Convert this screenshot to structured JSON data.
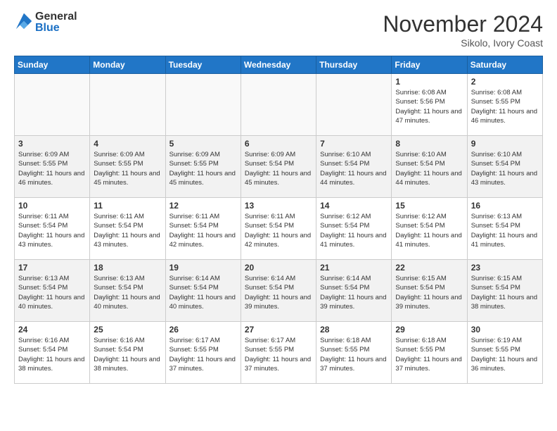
{
  "header": {
    "logo_general": "General",
    "logo_blue": "Blue",
    "month_title": "November 2024",
    "location": "Sikolo, Ivory Coast"
  },
  "days_of_week": [
    "Sunday",
    "Monday",
    "Tuesday",
    "Wednesday",
    "Thursday",
    "Friday",
    "Saturday"
  ],
  "weeks": [
    [
      {
        "day": "",
        "text": ""
      },
      {
        "day": "",
        "text": ""
      },
      {
        "day": "",
        "text": ""
      },
      {
        "day": "",
        "text": ""
      },
      {
        "day": "",
        "text": ""
      },
      {
        "day": "1",
        "text": "Sunrise: 6:08 AM\nSunset: 5:56 PM\nDaylight: 11 hours and 47 minutes."
      },
      {
        "day": "2",
        "text": "Sunrise: 6:08 AM\nSunset: 5:55 PM\nDaylight: 11 hours and 46 minutes."
      }
    ],
    [
      {
        "day": "3",
        "text": "Sunrise: 6:09 AM\nSunset: 5:55 PM\nDaylight: 11 hours and 46 minutes."
      },
      {
        "day": "4",
        "text": "Sunrise: 6:09 AM\nSunset: 5:55 PM\nDaylight: 11 hours and 45 minutes."
      },
      {
        "day": "5",
        "text": "Sunrise: 6:09 AM\nSunset: 5:55 PM\nDaylight: 11 hours and 45 minutes."
      },
      {
        "day": "6",
        "text": "Sunrise: 6:09 AM\nSunset: 5:54 PM\nDaylight: 11 hours and 45 minutes."
      },
      {
        "day": "7",
        "text": "Sunrise: 6:10 AM\nSunset: 5:54 PM\nDaylight: 11 hours and 44 minutes."
      },
      {
        "day": "8",
        "text": "Sunrise: 6:10 AM\nSunset: 5:54 PM\nDaylight: 11 hours and 44 minutes."
      },
      {
        "day": "9",
        "text": "Sunrise: 6:10 AM\nSunset: 5:54 PM\nDaylight: 11 hours and 43 minutes."
      }
    ],
    [
      {
        "day": "10",
        "text": "Sunrise: 6:11 AM\nSunset: 5:54 PM\nDaylight: 11 hours and 43 minutes."
      },
      {
        "day": "11",
        "text": "Sunrise: 6:11 AM\nSunset: 5:54 PM\nDaylight: 11 hours and 43 minutes."
      },
      {
        "day": "12",
        "text": "Sunrise: 6:11 AM\nSunset: 5:54 PM\nDaylight: 11 hours and 42 minutes."
      },
      {
        "day": "13",
        "text": "Sunrise: 6:11 AM\nSunset: 5:54 PM\nDaylight: 11 hours and 42 minutes."
      },
      {
        "day": "14",
        "text": "Sunrise: 6:12 AM\nSunset: 5:54 PM\nDaylight: 11 hours and 41 minutes."
      },
      {
        "day": "15",
        "text": "Sunrise: 6:12 AM\nSunset: 5:54 PM\nDaylight: 11 hours and 41 minutes."
      },
      {
        "day": "16",
        "text": "Sunrise: 6:13 AM\nSunset: 5:54 PM\nDaylight: 11 hours and 41 minutes."
      }
    ],
    [
      {
        "day": "17",
        "text": "Sunrise: 6:13 AM\nSunset: 5:54 PM\nDaylight: 11 hours and 40 minutes."
      },
      {
        "day": "18",
        "text": "Sunrise: 6:13 AM\nSunset: 5:54 PM\nDaylight: 11 hours and 40 minutes."
      },
      {
        "day": "19",
        "text": "Sunrise: 6:14 AM\nSunset: 5:54 PM\nDaylight: 11 hours and 40 minutes."
      },
      {
        "day": "20",
        "text": "Sunrise: 6:14 AM\nSunset: 5:54 PM\nDaylight: 11 hours and 39 minutes."
      },
      {
        "day": "21",
        "text": "Sunrise: 6:14 AM\nSunset: 5:54 PM\nDaylight: 11 hours and 39 minutes."
      },
      {
        "day": "22",
        "text": "Sunrise: 6:15 AM\nSunset: 5:54 PM\nDaylight: 11 hours and 39 minutes."
      },
      {
        "day": "23",
        "text": "Sunrise: 6:15 AM\nSunset: 5:54 PM\nDaylight: 11 hours and 38 minutes."
      }
    ],
    [
      {
        "day": "24",
        "text": "Sunrise: 6:16 AM\nSunset: 5:54 PM\nDaylight: 11 hours and 38 minutes."
      },
      {
        "day": "25",
        "text": "Sunrise: 6:16 AM\nSunset: 5:54 PM\nDaylight: 11 hours and 38 minutes."
      },
      {
        "day": "26",
        "text": "Sunrise: 6:17 AM\nSunset: 5:55 PM\nDaylight: 11 hours and 37 minutes."
      },
      {
        "day": "27",
        "text": "Sunrise: 6:17 AM\nSunset: 5:55 PM\nDaylight: 11 hours and 37 minutes."
      },
      {
        "day": "28",
        "text": "Sunrise: 6:18 AM\nSunset: 5:55 PM\nDaylight: 11 hours and 37 minutes."
      },
      {
        "day": "29",
        "text": "Sunrise: 6:18 AM\nSunset: 5:55 PM\nDaylight: 11 hours and 37 minutes."
      },
      {
        "day": "30",
        "text": "Sunrise: 6:19 AM\nSunset: 5:55 PM\nDaylight: 11 hours and 36 minutes."
      }
    ]
  ]
}
